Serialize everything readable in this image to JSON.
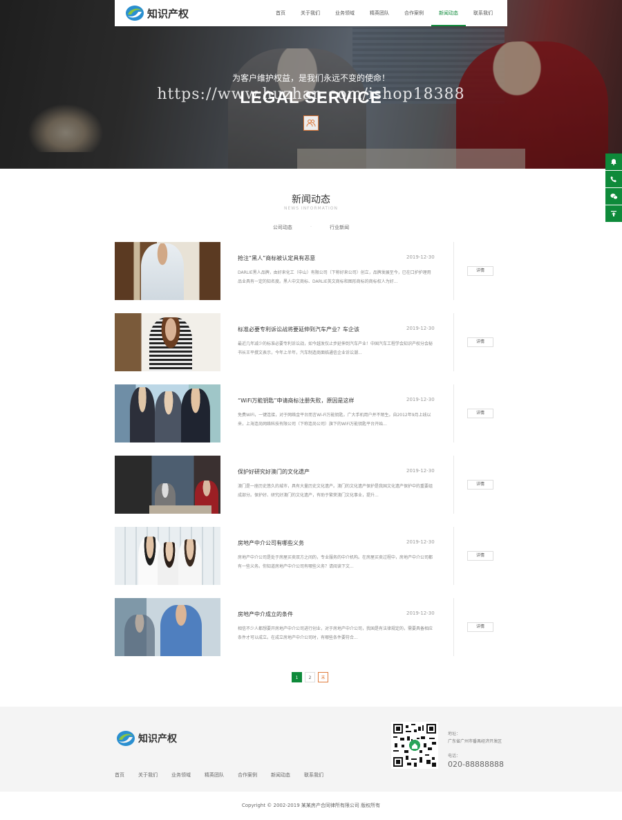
{
  "header": {
    "logo_text": "知识产权",
    "nav": [
      "首页",
      "关于我们",
      "业务领域",
      "精英团队",
      "合作案例",
      "新闻动态",
      "联系我们"
    ],
    "active_index": 5
  },
  "hero": {
    "slogan": "为客户维护权益，是我们永远不变的使命！",
    "title": "LEGAL SERVICE",
    "watermark": "https://www.huzhan.com/ishop18388",
    "icon": "people-icon"
  },
  "side_tools": [
    "bell-icon",
    "phone-icon",
    "wechat-icon",
    "back-to-top-icon"
  ],
  "section": {
    "title": "新闻动态",
    "subtitle": "NEWS INFORMATION",
    "tabs": [
      "公司动态",
      "行业新闻"
    ]
  },
  "news": [
    {
      "title": "抢注“黑人”商标被认定具有恶意",
      "date": "2019-12-30",
      "desc": "DARLIE黑人品牌，由好来化工（中山）有限公司（下称好来公司）创立，品牌发展至今，已在口护护理用品业具有一定的知名度。黑人中文商标、DARLIE英文商标和图形商标的商标权人为好...",
      "btn": "详情"
    },
    {
      "title": "标准必要专利诉讼战将要延伸到汽车产业？车企该",
      "date": "2019-12-30",
      "desc": "最近几年减少的标准必要专利诉讼战，如今越发仅止步延伸到汽车产业！中国汽车工程学会知识产权分会秘书长王平撰文表示，今年上半年，汽车制造商面临通信企业诉讼潮...",
      "btn": "详情"
    },
    {
      "title": "“WiFi万能钥匙”申请商标注册失败，原因是这样",
      "date": "2019-12-30",
      "desc": "免费WiFi，一键连接，对于网络金平台而言Wi-Fi万能钥匙，广大手机用户并不陌生。自2012年9月上线以来，上海连尚网络科技有限公司（下称连尚公司）旗下的WiFi万能钥匙平台开始...",
      "btn": "详情"
    },
    {
      "title": "保护好研究好澳门的文化遗产",
      "date": "2019-12-30",
      "desc": "澳门是一座历史悠久的城市，具有大量历史文化遗产。澳门的文化遗产保护是我国文化遗产保护中的重要组成部分。保护好、研究好澳门的文化遗产，有助于繁荣澳门文化事业，提升...",
      "btn": "详情"
    },
    {
      "title": "房地产中介公司有哪些义务",
      "date": "2019-12-30",
      "desc": "房地产中介公司是处于房屋买卖双方之间的，专业服务的中介机构。在房屋买卖过程中，房地产中介公司都有一些义务。你知道房地产中介公司有哪些义务？请阅读下文...",
      "btn": "详情"
    },
    {
      "title": "房地产中介成立的条件",
      "date": "2019-12-30",
      "desc": "相信不少人都想要开房地产中介公司进行创业，对于房地产中介公司，我国是有法律规定的，需要具备相应条件才可以成立。在成立房地产中介公司时，有哪些条件要符合...",
      "btn": "详情"
    }
  ],
  "pager": [
    "1",
    "2",
    "末"
  ],
  "footer": {
    "logo_text": "知识产权",
    "nav": [
      "首页",
      "关于我们",
      "业务领域",
      "精英团队",
      "合作案例",
      "新闻动态",
      "联系我们"
    ],
    "address_label": "地址：",
    "address": "广东省广州市番禺经济开发区",
    "phone_label": "电话：",
    "phone": "020-88888888"
  },
  "copyright": "Copyright © 2002-2019 某某房产合同律所有限公司 版权所有",
  "colors": {
    "brand_green": "#0e8a3a",
    "accent_orange": "#e07a3a"
  }
}
